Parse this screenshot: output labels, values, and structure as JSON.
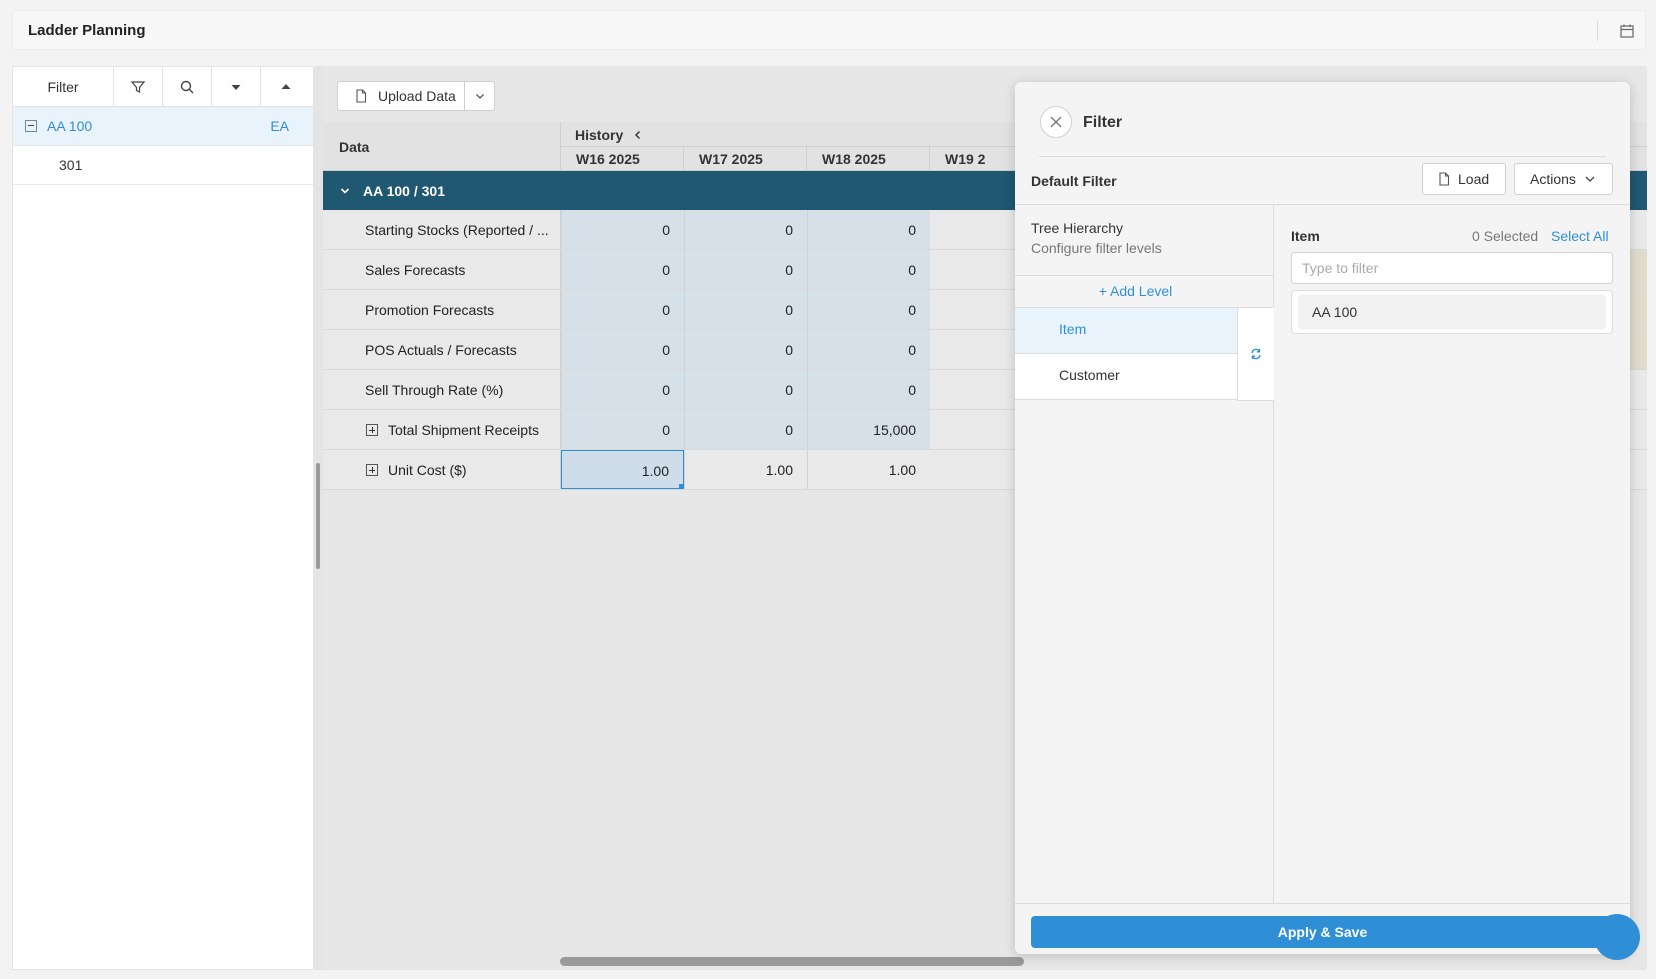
{
  "app": {
    "title": "Ladder Planning",
    "calendar_icon": "calendar-icon"
  },
  "left_pane": {
    "filter_label": "Filter",
    "icons": [
      "funnel-icon",
      "search-icon",
      "caret-down-icon",
      "caret-up-icon"
    ],
    "tree": [
      {
        "label": "AA 100",
        "uom": "EA"
      },
      {
        "label": "301"
      }
    ]
  },
  "toolbar": {
    "upload_label": "Upload Data"
  },
  "grid": {
    "data_header": "Data",
    "history_label": "History",
    "weeks": [
      "W16 2025",
      "W17 2025",
      "W18 2025",
      "W19 2"
    ],
    "group_label": "AA 100 / 301",
    "rows": [
      {
        "label": "Starting Stocks (Reported / ...",
        "values": [
          "0",
          "0",
          "0"
        ]
      },
      {
        "label": "Sales Forecasts",
        "values": [
          "0",
          "0",
          "0"
        ]
      },
      {
        "label": "Promotion Forecasts",
        "values": [
          "0",
          "0",
          "0"
        ]
      },
      {
        "label": "POS Actuals / Forecasts",
        "values": [
          "0",
          "0",
          "0"
        ]
      },
      {
        "label": "Sell Through Rate (%)",
        "values": [
          "0",
          "0",
          "0"
        ]
      },
      {
        "label": "Total Shipment Receipts",
        "values": [
          "0",
          "0",
          "15,000"
        ],
        "expandable": true
      },
      {
        "label": "Unit Cost ($)",
        "values": [
          "1.00",
          "1.00",
          "1.00"
        ],
        "expandable": true
      }
    ]
  },
  "filter_panel": {
    "title": "Filter",
    "default_filter": "Default Filter",
    "load_label": "Load",
    "actions_label": "Actions",
    "tree_hierarchy": "Tree Hierarchy",
    "tree_hierarchy_sub": "Configure filter levels",
    "add_level": "+ Add Level",
    "levels": [
      "Item",
      "Customer"
    ],
    "item_title": "Item",
    "selected_count": "0 Selected",
    "select_all": "Select All",
    "filter_placeholder": "Type to filter",
    "values": [
      "AA 100"
    ],
    "apply_label": "Apply & Save"
  },
  "colors": {
    "accent": "#2f8fd6",
    "group_header": "#1f5870"
  }
}
